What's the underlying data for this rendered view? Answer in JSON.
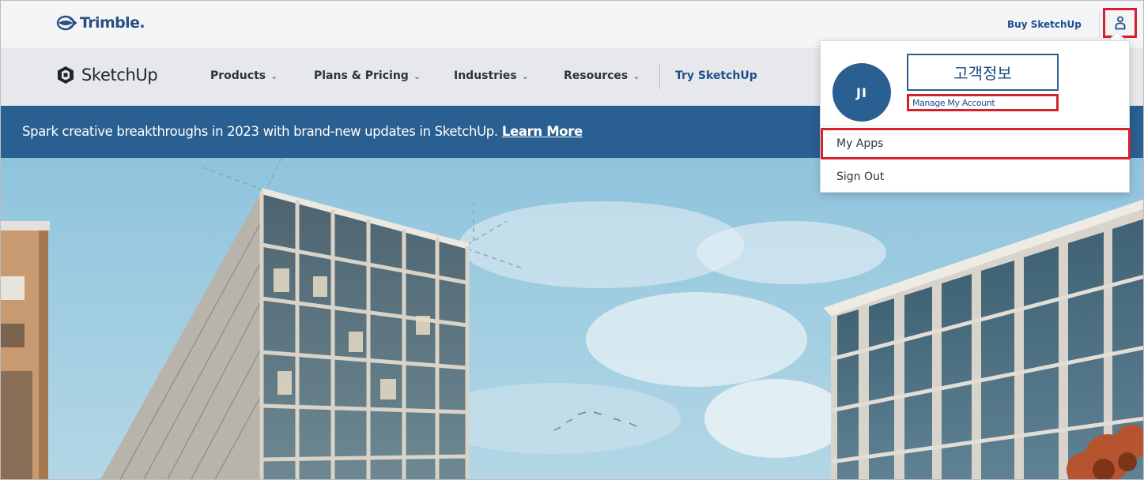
{
  "trimble_bar": {
    "logo_text": "Trimble.",
    "buy_link": "Buy SketchUp",
    "user_icon": "user-icon"
  },
  "nav": {
    "logo_text": "SketchUp",
    "items": [
      {
        "label": "Products",
        "chevron": "⌄"
      },
      {
        "label": "Plans & Pricing",
        "chevron": "⌄"
      },
      {
        "label": "Industries",
        "chevron": "⌄"
      },
      {
        "label": "Resources",
        "chevron": "⌄"
      }
    ],
    "try_link": "Try SketchUp"
  },
  "promo": {
    "text": "Spark creative breakthroughs in 2023 with brand-new updates in SketchUp.",
    "link": "Learn More"
  },
  "account_menu": {
    "avatar_initials": "JI",
    "annotation_label": "고객정보",
    "manage_account": "Manage My Account",
    "items": [
      {
        "label": "My Apps"
      },
      {
        "label": "Sign Out"
      }
    ]
  },
  "colors": {
    "brand_blue": "#2a5f91",
    "link_blue": "#1f4e8c",
    "highlight_red": "#d7212a",
    "trimble_bar_bg": "#f4f5f7",
    "nav_bg": "#e6e8ec"
  }
}
